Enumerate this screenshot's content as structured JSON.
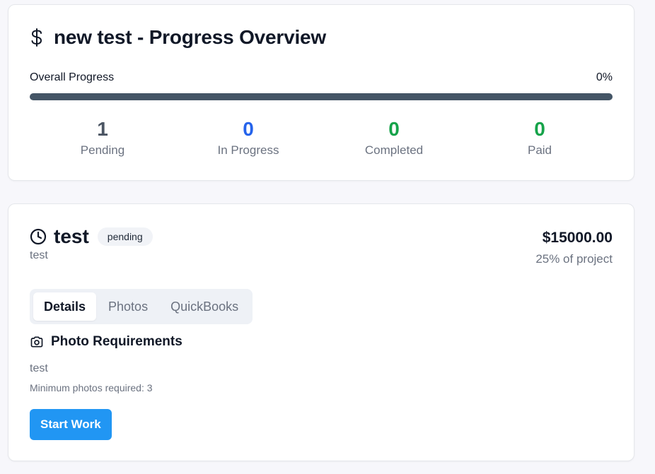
{
  "overview": {
    "title": "new test - Progress Overview",
    "icon": "dollar-icon",
    "progress_label": "Overall Progress",
    "progress_value_text": "0%",
    "progress_fraction": 0,
    "stats": [
      {
        "value": "1",
        "label": "Pending",
        "color": "#4b5563"
      },
      {
        "value": "0",
        "label": "In Progress",
        "color": "#2563eb"
      },
      {
        "value": "0",
        "label": "Completed",
        "color": "#16a34a"
      },
      {
        "value": "0",
        "label": "Paid",
        "color": "#16a34a"
      }
    ]
  },
  "milestone": {
    "icon": "clock-icon",
    "title": "test",
    "status_badge": "pending",
    "subtitle": "test",
    "amount": "$15000.00",
    "amount_share": "25% of project",
    "tabs": [
      {
        "label": "Details",
        "active": true
      },
      {
        "label": "Photos",
        "active": false
      },
      {
        "label": "QuickBooks",
        "active": false
      }
    ],
    "photo_section": {
      "icon": "camera-icon",
      "title": "Photo Requirements",
      "description": "test",
      "min_photos": "Minimum photos required: 3"
    },
    "start_button": "Start Work",
    "start_button_color": "#2196f3"
  }
}
